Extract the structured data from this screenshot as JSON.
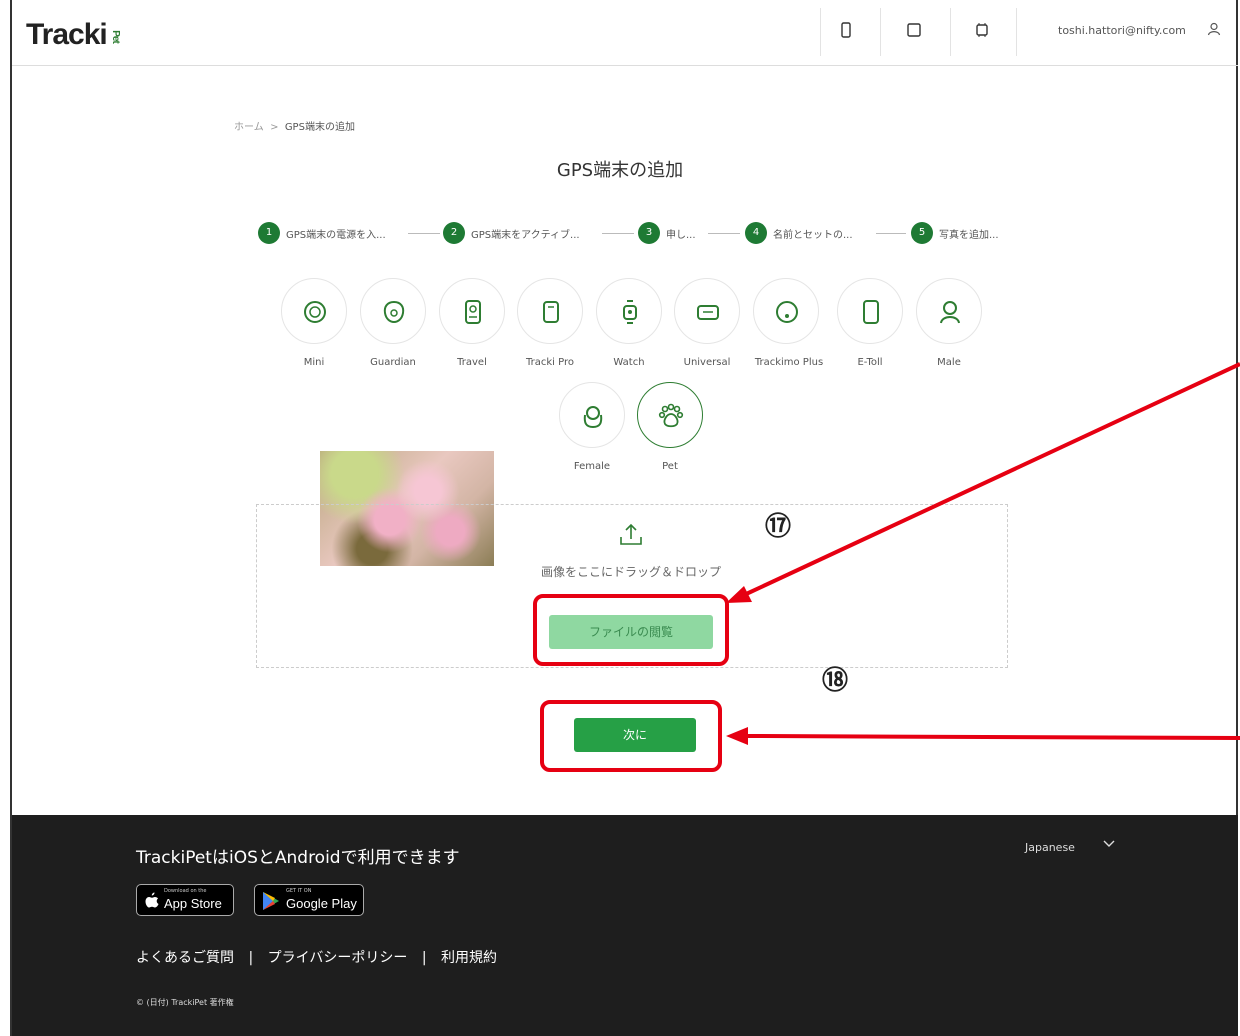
{
  "header": {
    "logo": "Tracki",
    "logo_sub": "Pet",
    "icons": [
      "phone-icon",
      "square-icon",
      "device-icon"
    ],
    "user_email": "toshi.hattori@nifty.com"
  },
  "breadcrumb": {
    "home": "ホーム",
    "separator": ">",
    "current": "GPS端末の追加"
  },
  "page_title": "GPS端末の追加",
  "steps": [
    {
      "num": "1",
      "label": "GPS端末の電源を入..."
    },
    {
      "num": "2",
      "label": "GPS端末をアクティブ..."
    },
    {
      "num": "3",
      "label": "申し..."
    },
    {
      "num": "4",
      "label": "名前とセットの..."
    },
    {
      "num": "5",
      "label": "写真を追加..."
    }
  ],
  "devices": [
    {
      "label": "Mini",
      "icon": "mini-icon"
    },
    {
      "label": "Guardian",
      "icon": "guardian-icon"
    },
    {
      "label": "Travel",
      "icon": "travel-icon"
    },
    {
      "label": "Tracki Pro",
      "icon": "tracki-pro-icon"
    },
    {
      "label": "Watch",
      "icon": "watch-icon"
    },
    {
      "label": "Universal",
      "icon": "universal-icon"
    },
    {
      "label": "Trackimo Plus",
      "icon": "trackimo-plus-icon"
    },
    {
      "label": "E-Toll",
      "icon": "e-toll-icon"
    },
    {
      "label": "Male",
      "icon": "male-icon"
    },
    {
      "label": "Female",
      "icon": "female-icon"
    },
    {
      "label": "Pet",
      "icon": "paw-icon",
      "selected": true
    }
  ],
  "upload": {
    "drop_text": "画像をここにドラッグ＆ドロップ",
    "browse_label": "ファイルの閲覧"
  },
  "next_label": "次に",
  "annotations": {
    "browse": "⑰",
    "next": "⑱"
  },
  "colors": {
    "accent": "#26a046",
    "annotation": "#e60012",
    "footer_bg": "#1e1e1e"
  },
  "footer": {
    "tagline": "TrackiPetはiOSとAndroidで利用できます",
    "language": "Japanese",
    "app_store": {
      "small": "Download on the",
      "big": "App Store"
    },
    "google_play": {
      "small": "GET IT ON",
      "big": "Google Play"
    },
    "links": [
      "よくあるご質問",
      "|",
      "プライバシーポリシー",
      "|",
      "利用規約"
    ],
    "copyright": "© (日付) TrackiPet 著作権"
  }
}
